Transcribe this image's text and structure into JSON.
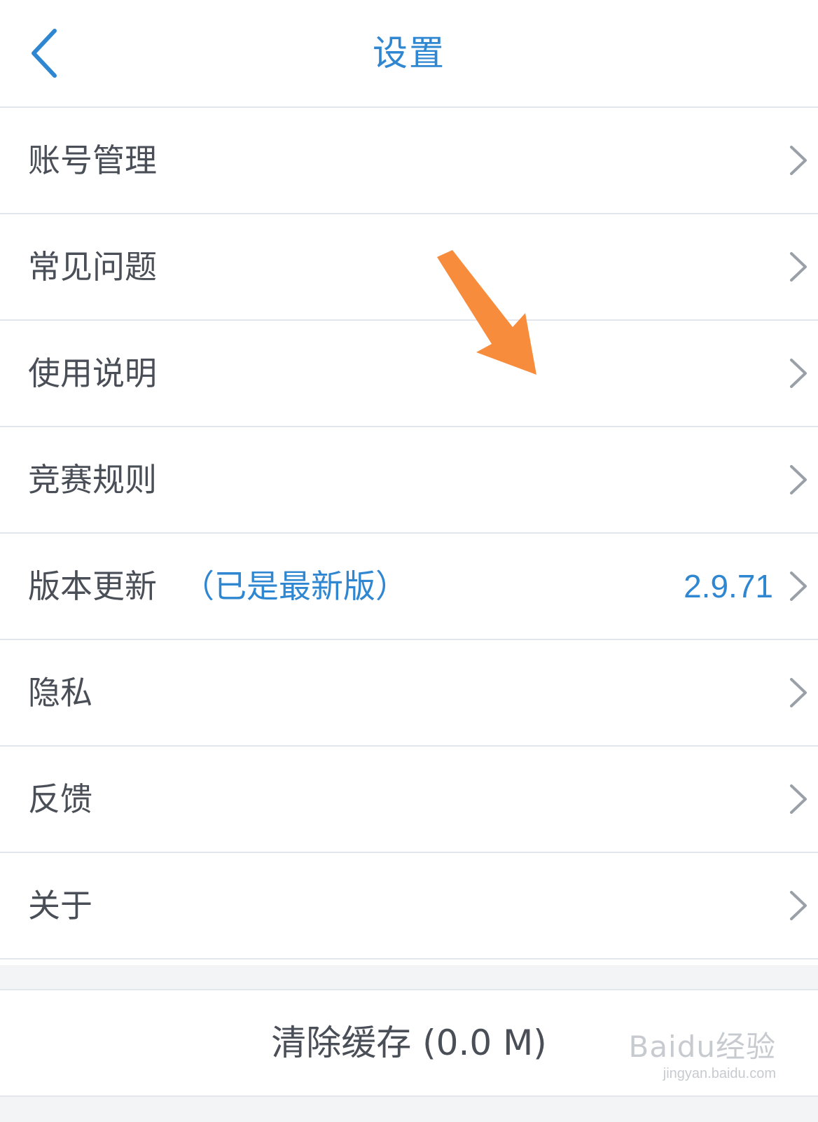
{
  "header": {
    "title": "设置",
    "back_icon": "chevron-left-icon"
  },
  "colors": {
    "accent": "#2f86d1",
    "text": "#4a4f57",
    "divider": "#e3e6ea",
    "background_band": "#f3f4f6",
    "annotation_arrow": "#f78d3c"
  },
  "menu": {
    "items": [
      {
        "label": "账号管理"
      },
      {
        "label": "常见问题"
      },
      {
        "label": "使用说明"
      },
      {
        "label": "竞赛规则"
      },
      {
        "label": "版本更新",
        "tag": "（已是最新版）",
        "value": "2.9.71"
      },
      {
        "label": "隐私"
      },
      {
        "label": "反馈"
      },
      {
        "label": "关于"
      }
    ],
    "chevron_icon": "chevron-right-icon"
  },
  "footer": {
    "clear_cache_label": "清除缓存 (0.0 M)"
  },
  "watermark": {
    "main": "Baidu经验",
    "sub": "jingyan.baidu.com"
  }
}
